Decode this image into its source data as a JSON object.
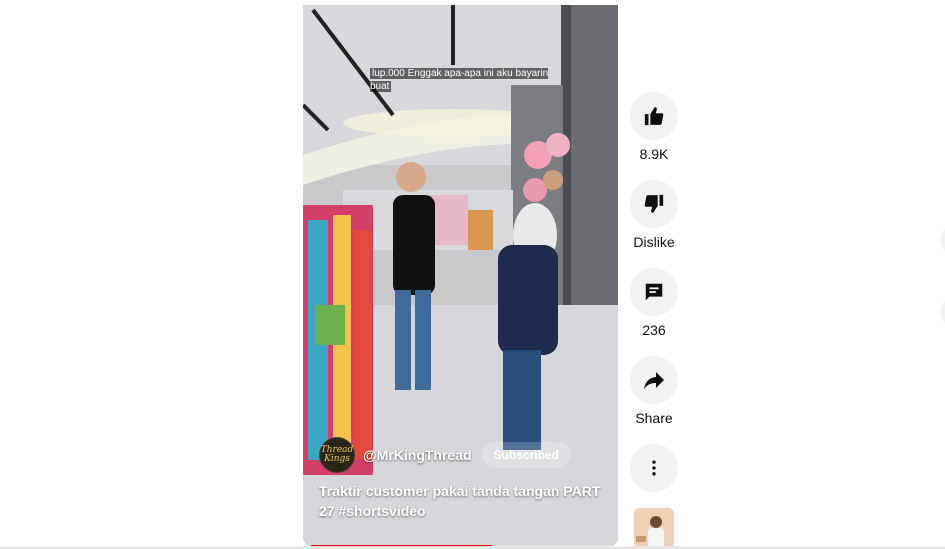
{
  "video": {
    "caption": "lup.000 Enggak apa-apa ini aku bayarin buat",
    "channel_name": "@MrKingThread",
    "avatar_text": "Thread Kings",
    "subscribe_label": "Subscribed",
    "title": "Traktir customer pakai tanda tangan PART 27 #shortsvideo",
    "progress": 0.59
  },
  "actions": {
    "like_count": "8.9K",
    "dislike_label": "Dislike",
    "comment_count": "236",
    "share_label": "Share"
  },
  "icons": {
    "like": "thumb-up-icon",
    "dislike": "thumb-down-icon",
    "comment": "comment-icon",
    "share": "share-icon",
    "more": "more-vertical-icon"
  },
  "colors": {
    "progress": "#ff0000",
    "action_bg": "#f2f2f2"
  }
}
